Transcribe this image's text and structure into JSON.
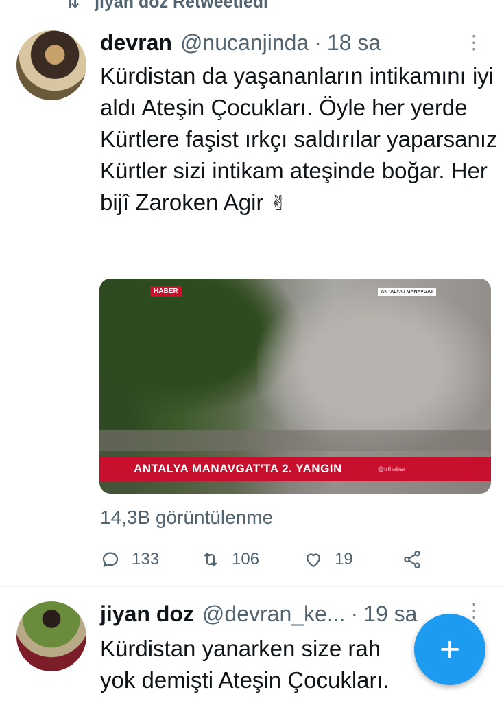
{
  "retweet_bar": {
    "icon": "retweet-icon",
    "text": "jiyan doz Retweetledi"
  },
  "tweets": [
    {
      "display_name": "devran",
      "handle": "@nucanjinda",
      "separator": "·",
      "time": "18 sa",
      "text": "Kürdistan da yaşananların intikamını iyi aldı Ateşin Çocukları. Öyle her yerde Kürtlere faşist ırkçı saldırılar yaparsanız Kürtler sizi intikam ateşinde boğar. Her bijî Zaroken Agir",
      "emoji": "✌",
      "media": {
        "channel_tag": "HABER",
        "location_tag": "ANTALYA / MANAVGAT",
        "headline": "ANTALYA MANAVGAT'TA 2. YANGIN",
        "logo_text": "@trthaber"
      },
      "views": "14,3B görüntülenme",
      "actions": {
        "reply_count": "133",
        "retweet_count": "106",
        "like_count": "19"
      }
    },
    {
      "display_name": "jiyan doz",
      "handle": "@devran_ke...",
      "separator": "·",
      "time": "19 sa",
      "text_line1": "Kürdistan yanarken size rah",
      "text_line2": "yok demişti Ateşin Çocukları."
    }
  ],
  "fab": {
    "icon": "plus-icon",
    "label": "+"
  },
  "colors": {
    "accent": "#1d9bf0",
    "secondary_text": "#536471",
    "news_red": "#c8102e"
  }
}
